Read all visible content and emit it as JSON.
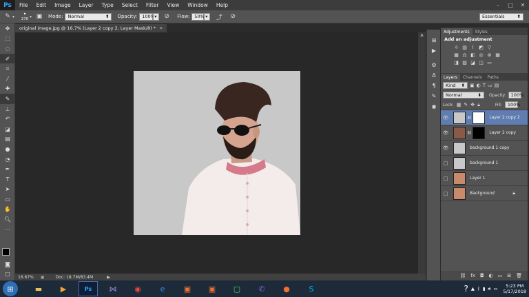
{
  "menu": {
    "logo": "Ps",
    "items": [
      "File",
      "Edit",
      "Image",
      "Layer",
      "Type",
      "Select",
      "Filter",
      "View",
      "Window",
      "Help"
    ]
  },
  "options": {
    "brush_size": "270",
    "mode_label": "Mode:",
    "mode_value": "Normal",
    "opacity_label": "Opacity:",
    "opacity_value": "100%",
    "flow_label": "Flow:",
    "flow_value": "50%",
    "workspace": "Essentials"
  },
  "doc_tab": {
    "title": "original image.jpg @ 16.7% (Layer 2 copy 2, Layer Mask/8) *"
  },
  "status": {
    "zoom": "16.67%",
    "doc": "Doc: 18.7M/83.4M"
  },
  "adjustments": {
    "tab1": "Adjustments",
    "tab2": "Styles",
    "title": "Add an adjustment"
  },
  "layers_panel": {
    "tab1": "Layers",
    "tab2": "Channels",
    "tab3": "Paths",
    "kind": "Kind",
    "blend": "Normal",
    "opacity_label": "Opacity:",
    "opacity_value": "100%",
    "lock_label": "Lock:",
    "fill_label": "Fill:",
    "fill_value": "100%",
    "layers": [
      {
        "name": "Layer 2 copy 2",
        "visible": true,
        "selected": true
      },
      {
        "name": "Layer 2 copy",
        "visible": true,
        "selected": false
      },
      {
        "name": "background 1 copy",
        "visible": true,
        "selected": false
      },
      {
        "name": "background 1",
        "visible": false,
        "selected": false
      },
      {
        "name": "Layer 1",
        "visible": false,
        "selected": false
      },
      {
        "name": "Background",
        "visible": false,
        "selected": false
      }
    ]
  },
  "clock": {
    "time": "5:23 PM",
    "date": "5/17/2018"
  },
  "colors": {
    "accent": "#31a8ff",
    "selected_layer": "#5f7db0"
  }
}
